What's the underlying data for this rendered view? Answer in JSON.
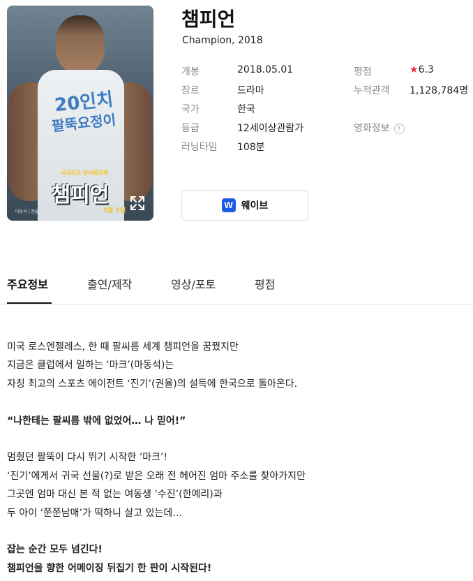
{
  "movie": {
    "title": "챔피언",
    "subtitle": "Champion, 2018"
  },
  "poster": {
    "shirt_line1": "20인치",
    "shirt_line2": "팔뚝요정이",
    "tagline": "국내최초 팔씨름영화",
    "title": "챔피언",
    "credits": "마동석 / 권율 / 한예리",
    "date": "5월 1일",
    "expand_icon": "expand-icon"
  },
  "info": {
    "left": [
      {
        "label": "개봉",
        "value": "2018.05.01"
      },
      {
        "label": "장르",
        "value": "드라마"
      },
      {
        "label": "국가",
        "value": "한국"
      },
      {
        "label": "등급",
        "value": "12세이상관람가"
      },
      {
        "label": "러닝타임",
        "value": "108분"
      }
    ],
    "right": {
      "rating_label": "평점",
      "rating_star": "★",
      "rating_value": "6.3",
      "audience_label": "누적관객",
      "audience_value": "1,128,784명",
      "movieinfo_label": "영화정보",
      "movieinfo_badge": "!"
    }
  },
  "watch_button": {
    "logo": "W",
    "label": "웨이브",
    "brand_color": "#1a5ce6"
  },
  "tabs": [
    {
      "label": "주요정보",
      "active": true
    },
    {
      "label": "출연/제작",
      "active": false
    },
    {
      "label": "영상/포토",
      "active": false
    },
    {
      "label": "평점",
      "active": false
    }
  ],
  "synopsis": {
    "p1": [
      "미국 로스엔젤레스, 한 때 팔씨름 세계 챔피언을 꿈꿨지만",
      "지금은 클럽에서 일하는 ‘마크’(마동석)는",
      "자칭 최고의 스포츠 에이전트 ‘진기’(권율)의 설득에 한국으로 돌아온다."
    ],
    "quote": "“나한테는 팔씨름 밖에 없었어… 나 믿어!”",
    "p2": [
      "멈췄던 팔뚝이 다시 뛰기 시작한 ‘마크’!",
      "‘진기’에게서 귀국 선물(?)로 받은 오래 전 헤어진 엄마 주소를 찾아가지만",
      "그곳엔 엄마 대신 본 적 없는 여동생 ‘수진’(한예리)과",
      "두 아이 ‘쭌쭌남매’가 떡하니 살고 있는데…"
    ],
    "closing": [
      "잡는 순간 모두 넘긴다!",
      "챔피언을 향한 어메이징 뒤집기 한 판이 시작된다!"
    ]
  },
  "colors": {
    "star": "#ef2d37",
    "label": "#8a8a8a"
  }
}
